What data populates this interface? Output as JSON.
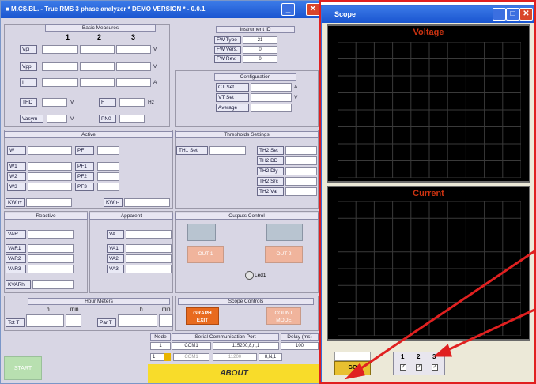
{
  "main": {
    "title": "■ M.CS.BL. - True RMS 3 phase analyzer * DEMO VERSION * - 0.0.1",
    "buttons": {
      "minimize": "_",
      "close": "✕"
    },
    "basic": {
      "header": "Basic Measures",
      "cols": [
        "1",
        "2",
        "3"
      ],
      "rows": [
        {
          "label": "Vpi",
          "unit": "V"
        },
        {
          "label": "Vpp",
          "unit": "V"
        },
        {
          "label": "I",
          "unit": "A"
        }
      ],
      "thd": {
        "label": "THD",
        "unit": "V"
      },
      "freq": {
        "label": "F",
        "unit": "Hz"
      },
      "vasym": {
        "label": "Vasym",
        "unit": "V"
      },
      "pn0": {
        "label": "PN0"
      }
    },
    "instrument": {
      "header": "Instrument ID",
      "rows": [
        {
          "label": "FW Type",
          "value": "21"
        },
        {
          "label": "FW Vers.",
          "value": "0"
        },
        {
          "label": "FW Rev.",
          "value": "0"
        }
      ]
    },
    "config": {
      "header": "Configuration",
      "rows": [
        {
          "label": "CT Set",
          "unit": "A"
        },
        {
          "label": "VT Set",
          "unit": "V"
        },
        {
          "label": "Average",
          "unit": ""
        }
      ]
    },
    "active": {
      "header": "Active",
      "w": "W",
      "pf": "PF",
      "rows": [
        {
          "w": "W1",
          "pf": "PF1"
        },
        {
          "w": "W2",
          "pf": "PF2"
        },
        {
          "w": "W3",
          "pf": "PF3"
        }
      ],
      "kwhp": "KWh+",
      "kwhm": "KWh-"
    },
    "thresholds": {
      "header": "Thresholds Settings",
      "th1": "TH1 Set",
      "th2": [
        "TH2 Set",
        "TH2 DD",
        "TH2 Dly",
        "TH2 Src",
        "TH2 Val"
      ]
    },
    "reactive": {
      "header": "Reactive",
      "rows": [
        "VAR",
        "VAR1",
        "VAR2",
        "VAR3"
      ],
      "kvarh": "KVARh"
    },
    "apparent": {
      "header": "Apparent",
      "rows": [
        "VA",
        "VA1",
        "VA2",
        "VA3"
      ]
    },
    "outputs": {
      "header": "Outputs Control",
      "out1": "OUT 1",
      "out2": "OUT 2",
      "led": "Led1"
    },
    "hour": {
      "header": "Hour Meters",
      "h": "h",
      "min": "min",
      "tot": "Tot T",
      "par": "Par T"
    },
    "scope_controls": {
      "header": "Scope Controls",
      "graph": "GRAPH\nEXIT",
      "count": "COUNT\nMODE"
    },
    "comm": {
      "node_header": "Node",
      "serial_header": "Serial Communication Port",
      "delay_header": "Delay (ms)",
      "node": "1",
      "port": "COM1",
      "baud": "115200,8,n,1",
      "delay": "100",
      "node_sel": "1",
      "port_sel": "COM1",
      "baud_sel": "11200",
      "parity": "8,N,1"
    },
    "start": "START",
    "about": "ABOUT"
  },
  "scope": {
    "title": "Scope",
    "voltage": "Voltage",
    "current": "Current",
    "go": "GO",
    "channels": [
      "1",
      "2",
      "3"
    ]
  }
}
